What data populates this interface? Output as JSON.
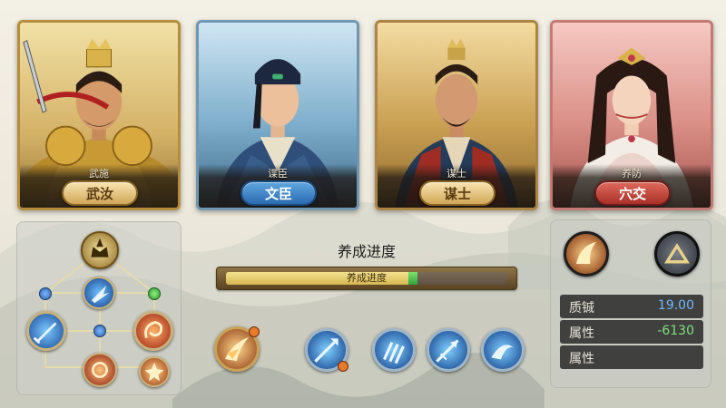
{
  "characters": [
    {
      "id": "wujiang",
      "top_label": "武施",
      "button_label": "武汝",
      "theme": "gold"
    },
    {
      "id": "wenchen",
      "top_label": "谍臣",
      "button_label": "文臣",
      "theme": "blue"
    },
    {
      "id": "moushi",
      "top_label": "谋士",
      "button_label": "谋士",
      "theme": "amber"
    },
    {
      "id": "waijiao",
      "top_label": "养防",
      "button_label": "穴交",
      "theme": "rose"
    }
  ],
  "progress": {
    "title": "养成进度",
    "bar_label": "养成进度",
    "fill_fraction": 0.68,
    "fill_color": "#d7b851",
    "tip_color": "#2fa33b"
  },
  "stats": {
    "rows": [
      {
        "label": "质铖",
        "value": "19.00",
        "value_color": "#6fb7ff"
      },
      {
        "label": "属性",
        "value": "-6130",
        "value_color": "#7fe07a"
      },
      {
        "label": "属性",
        "value": "",
        "value_color": "#ffffff"
      }
    ]
  },
  "skill_tree": {
    "nodes": [
      "crown-emblem-icon",
      "blue-orb-left",
      "green-orb-right",
      "blue-slash-icon",
      "sword-icon",
      "fire-swirl-icon",
      "blue-orb-mid",
      "fire-ring-icon",
      "fire-burst-icon"
    ]
  },
  "skill_bar": {
    "icons": [
      "fire-slash-icon",
      "blue-arrow-icon",
      "blue-claw-icon",
      "blue-spear-icon",
      "blue-wind-icon"
    ],
    "badges": [
      "fire-slash-icon",
      "blue-arrow-icon"
    ]
  },
  "colors": {
    "accent_gold": "#d2a85a",
    "accent_blue": "#2a6cb0",
    "accent_red": "#a8302a"
  }
}
